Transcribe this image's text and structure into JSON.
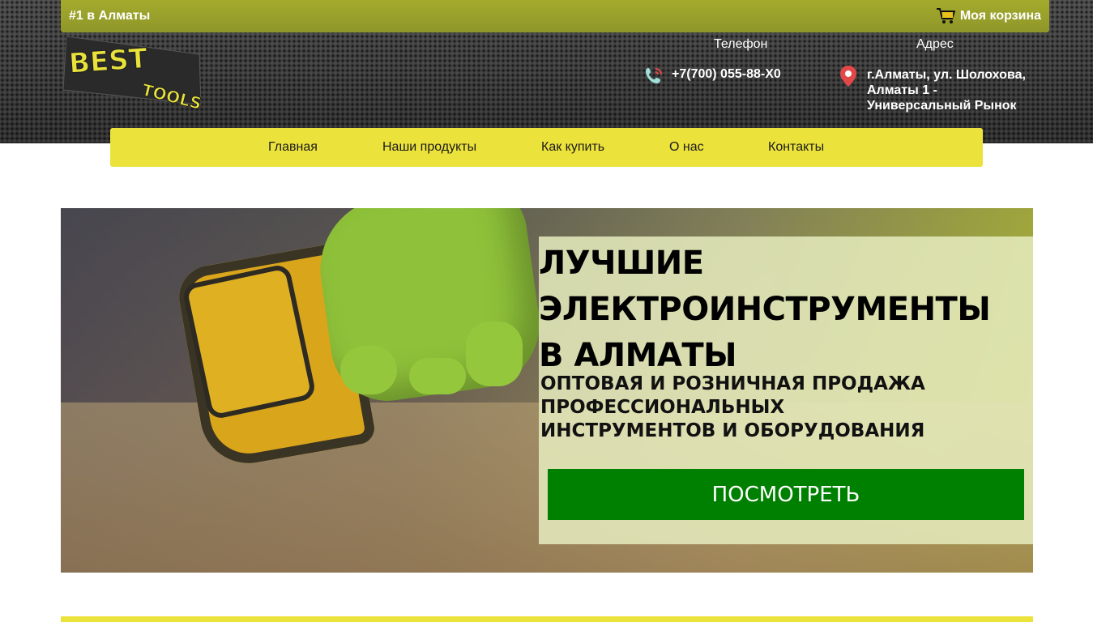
{
  "topbar": {
    "tagline": "#1 в Алматы",
    "cart_label": "Моя корзина",
    "cart_icon": "cart-icon"
  },
  "logo": {
    "line1": "BEST",
    "line2": "TOOLS"
  },
  "contacts": {
    "phone_label": "Телефон",
    "phone": "+7(700) 055-88-X0",
    "phone_icon": "phone-icon",
    "address_label": "Адрес",
    "address": "г.Алматы, ул. Шолохова, Алматы 1 - Универсальный Рынок",
    "address_icon": "location-pin-icon"
  },
  "nav": {
    "items": [
      {
        "label": "Главная"
      },
      {
        "label": "Наши продукты"
      },
      {
        "label": "Как купить"
      },
      {
        "label": "О нас"
      },
      {
        "label": "Контакты"
      }
    ]
  },
  "hero": {
    "title_line1": "ЛУЧШИЕ",
    "title_line2": "ЭЛЕКТРОИНСТРУМЕНТЫ",
    "title_line3": "В АЛМАТЫ",
    "sub_line1": "ОПТОВАЯ И РОЗНИЧНАЯ ПРОДАЖА",
    "sub_line2": "ПРОФЕССИОНАЛЬНЫХ",
    "sub_line3": "ИНСТРУМЕНТОВ И ОБОРУДОВАНИЯ",
    "button_label": "ПОСМОТРЕТЬ"
  },
  "colors": {
    "accent_yellow": "#ece23c",
    "topbar_olive": "#9ba02a",
    "button_green": "#008000"
  }
}
